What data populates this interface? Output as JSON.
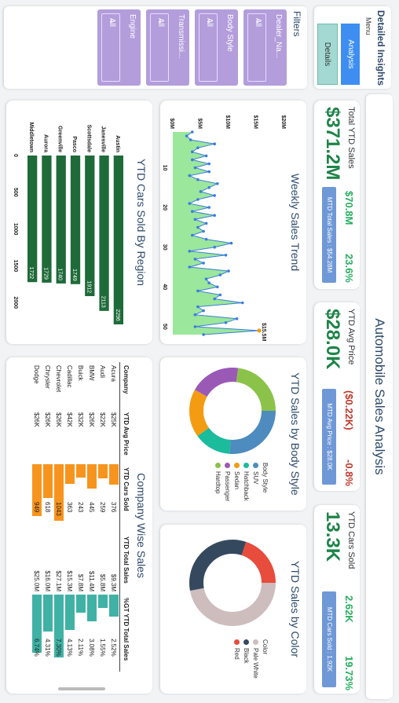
{
  "title": "Automobile Sales Analysis",
  "sidebar": {
    "brand": "Detailed Insights",
    "menu_label": "Menu",
    "nav": [
      {
        "label": "Analysis",
        "active": true
      },
      {
        "label": "Details",
        "active": false
      }
    ],
    "filters_label": "Filters",
    "filters": [
      {
        "label": "Dealer_Na...",
        "value": "All"
      },
      {
        "label": "Body Style",
        "value": "All"
      },
      {
        "label": "Transmissi...",
        "value": "All"
      },
      {
        "label": "Engine",
        "value": "All"
      }
    ]
  },
  "kpis": [
    {
      "label": "Total YTD Sales",
      "value": "$371.2M",
      "mtd_value": "$70.8M",
      "yoy": "23.6%",
      "mtd_text": "MTD Total Sales : $54.28M",
      "negative": false
    },
    {
      "label": "YTD Avg Price",
      "value": "$28.0K",
      "mtd_value": "($0.22K)",
      "yoy": "-0.8%",
      "mtd_text": "MTD Avg Price : $28.0K",
      "negative": true
    },
    {
      "label": "YTD Cars Sold",
      "value": "13.3K",
      "mtd_value": "2.62K",
      "yoy": "19.73%",
      "mtd_text": "MTD Cars Sold : 1.92K",
      "negative": false
    }
  ],
  "weekly": {
    "title": "Weekly Sales Trend",
    "peak_label": "$15.5M",
    "y_ticks": [
      "$20M",
      "$15M",
      "$10M",
      "$5M",
      "$0M"
    ],
    "x_ticks": [
      "10",
      "20",
      "30",
      "40",
      "50"
    ]
  },
  "body_style": {
    "title": "YTD Sales by Body Style",
    "legend_title": "Body Style",
    "items": [
      {
        "name": "SUV",
        "color": "#4e8bbf",
        "share": 0.26
      },
      {
        "name": "Hatchback",
        "color": "#1abc9c",
        "share": 0.14
      },
      {
        "name": "Sedan",
        "color": "#f39c12",
        "share": 0.18
      },
      {
        "name": "Passenger",
        "color": "#9b59b6",
        "share": 0.19
      },
      {
        "name": "Hardtop",
        "color": "#8bc34a",
        "share": 0.23
      }
    ]
  },
  "color_chart": {
    "title": "YTD Sales by Color",
    "legend_title": "Color",
    "items": [
      {
        "name": "Pale White",
        "color": "#cdbdbd",
        "share": 0.47
      },
      {
        "name": "Black",
        "color": "#34495e",
        "share": 0.33
      },
      {
        "name": "Red",
        "color": "#e74c3c",
        "share": 0.2
      }
    ]
  },
  "region": {
    "title": "YTD Cars Sold By Region",
    "x_ticks": [
      "0",
      "500",
      "1000",
      "1500",
      "2000"
    ]
  },
  "company": {
    "title": "Company Wise Sales",
    "headers": [
      "Company",
      "YTD Avg Price",
      "YTD Cars Sold",
      "YTD Total Sales",
      "%GT YTD Total Sales"
    ],
    "rows": [
      {
        "company": "Acura",
        "avg_price": "$25K",
        "cars_sold": "376",
        "total_sales": "$9.3M",
        "pct": "2.52%",
        "cars_num": 376,
        "pct_num": 2.52
      },
      {
        "company": "Audi",
        "avg_price": "$22K",
        "cars_sold": "259",
        "total_sales": "$5.8M",
        "pct": "1.55%",
        "cars_num": 259,
        "pct_num": 1.55
      },
      {
        "company": "BMW",
        "avg_price": "$26K",
        "cars_sold": "445",
        "total_sales": "$11.4M",
        "pct": "3.08%",
        "cars_num": 445,
        "pct_num": 3.08
      },
      {
        "company": "Buick",
        "avg_price": "$32K",
        "cars_sold": "243",
        "total_sales": "$7.8M",
        "pct": "2.11%",
        "cars_num": 243,
        "pct_num": 2.11
      },
      {
        "company": "Cadillac",
        "avg_price": "$42K",
        "cars_sold": "363",
        "total_sales": "$15.3M",
        "pct": "4.13%",
        "cars_num": 363,
        "pct_num": 4.13
      },
      {
        "company": "Chevrolet",
        "avg_price": "$26K",
        "cars_sold": "1043",
        "total_sales": "$27.1M",
        "pct": "7.30%",
        "cars_num": 1043,
        "pct_num": 7.3
      },
      {
        "company": "Chrysler",
        "avg_price": "$26K",
        "cars_sold": "618",
        "total_sales": "$16.0M",
        "pct": "4.31%",
        "cars_num": 618,
        "pct_num": 4.31
      },
      {
        "company": "Dodge",
        "avg_price": "$26K",
        "cars_sold": "949",
        "total_sales": "$25.0M",
        "pct": "6.74%",
        "cars_num": 949,
        "pct_num": 6.74
      }
    ]
  },
  "colors": {
    "accent_blue": "#3d8ef0",
    "teal_button": "#a3d9d2",
    "filter_purple": "#b39ddb",
    "kpi_green": "#1e8449",
    "region_bar": "#1e6b3a",
    "weekly_fill": "#9be79b",
    "weekly_point": "#3b7ddd",
    "cars_bar": "#f7941d",
    "pct_bar": "#3fb2a5"
  },
  "chart_data": [
    {
      "type": "area",
      "title": "Weekly Sales Trend",
      "x": [
        1,
        2,
        3,
        4,
        5,
        6,
        7,
        8,
        9,
        10,
        11,
        12,
        13,
        14,
        15,
        16,
        17,
        18,
        19,
        20,
        21,
        22,
        23,
        24,
        25,
        26,
        27,
        28,
        29,
        30,
        31,
        32,
        33,
        34,
        35,
        36,
        37,
        38,
        39,
        40,
        41,
        42,
        43,
        44,
        45,
        46,
        47,
        48,
        49,
        50,
        51,
        52
      ],
      "values": [
        3.5,
        2.5,
        3.2,
        7.5,
        4.5,
        3.5,
        6.0,
        3.5,
        6.5,
        4.0,
        6.5,
        3.0,
        4.5,
        8.0,
        6.5,
        5.0,
        7.5,
        4.5,
        3.0,
        6.5,
        3.5,
        7.5,
        4.0,
        6.0,
        4.5,
        5.5,
        3.5,
        6.0,
        10.5,
        7.5,
        3.0,
        9.5,
        4.0,
        5.5,
        3.0,
        10.0,
        8.5,
        6.0,
        6.5,
        8.0,
        4.5,
        8.5,
        7.5,
        12.5,
        4.5,
        5.5,
        4.0,
        11.5,
        9.5,
        4.0,
        15.5,
        5.5
      ],
      "xlabel": "",
      "ylabel": "",
      "ylim": [
        0,
        20
      ],
      "y_ticks": [
        "$0M",
        "$5M",
        "$10M",
        "$15M",
        "$20M"
      ],
      "x_ticks": [
        10,
        20,
        30,
        40,
        50
      ],
      "annotations": [
        "$15.5M"
      ]
    },
    {
      "type": "bar",
      "title": "YTD Cars Sold By Region",
      "categories": [
        "Austin",
        "Janesville",
        "Scottsdale",
        "Pasco",
        "Greenville",
        "Aurora",
        "Middletown"
      ],
      "values": [
        2296,
        2113,
        1912,
        1749,
        1740,
        1729,
        1722
      ],
      "xlim": [
        0,
        2000
      ],
      "x_ticks": [
        0,
        500,
        1000,
        1500,
        2000
      ]
    },
    {
      "type": "pie",
      "title": "YTD Sales by Body Style",
      "categories": [
        "SUV",
        "Hatchback",
        "Sedan",
        "Passenger",
        "Hardtop"
      ],
      "values": [
        0.26,
        0.14,
        0.18,
        0.19,
        0.23
      ],
      "legend": "Body Style"
    },
    {
      "type": "pie",
      "title": "YTD Sales by Color",
      "categories": [
        "Pale White",
        "Black",
        "Red"
      ],
      "values": [
        0.47,
        0.33,
        0.2
      ],
      "legend": "Color"
    },
    {
      "type": "table",
      "title": "Company Wise Sales",
      "columns": [
        "Company",
        "YTD Avg Price",
        "YTD Cars Sold",
        "YTD Total Sales",
        "%GT YTD Total Sales"
      ],
      "rows": [
        [
          "Acura",
          "$25K",
          "376",
          "$9.3M",
          "2.52%"
        ],
        [
          "Audi",
          "$22K",
          "259",
          "$5.8M",
          "1.55%"
        ],
        [
          "BMW",
          "$26K",
          "445",
          "$11.4M",
          "3.08%"
        ],
        [
          "Buick",
          "$32K",
          "243",
          "$7.8M",
          "2.11%"
        ],
        [
          "Cadillac",
          "$42K",
          "363",
          "$15.3M",
          "4.13%"
        ],
        [
          "Chevrolet",
          "$26K",
          "1043",
          "$27.1M",
          "7.30%"
        ],
        [
          "Chrysler",
          "$26K",
          "618",
          "$16.0M",
          "4.31%"
        ],
        [
          "Dodge",
          "$26K",
          "949",
          "$25.0M",
          "6.74%"
        ]
      ]
    }
  ]
}
